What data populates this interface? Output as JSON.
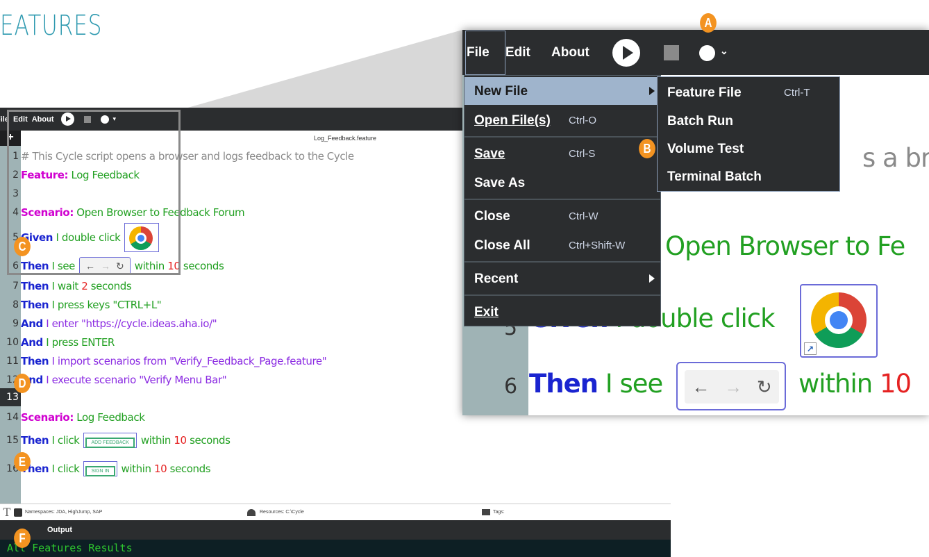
{
  "heading": "EATURES",
  "editor": {
    "menu": {
      "file": "File",
      "edit": "Edit",
      "about": "About"
    },
    "plus": "+",
    "tab_title": "Log_Feedback.feature",
    "lines": [
      {
        "n": "1",
        "comment": "# This Cycle script opens a browser and logs feedback to the Cycle"
      },
      {
        "n": "2",
        "kw": "Feature:",
        "text": " Log Feedback"
      },
      {
        "n": "3"
      },
      {
        "n": "4",
        "kw": "Scenario:",
        "text": " Open Browser to Feedback Forum"
      },
      {
        "n": "5",
        "kw": "Given",
        "text": " I double click"
      },
      {
        "n": "6",
        "kw": "Then",
        "text": " I see",
        "tail": "within",
        "num": "10",
        "tail2": "seconds"
      },
      {
        "n": "7",
        "kw": "Then",
        "text": " I wait",
        "num": "2",
        "tail2": "seconds"
      },
      {
        "n": "8",
        "kw": "Then",
        "text": " I press keys \"CTRL+L\""
      },
      {
        "n": "9",
        "kw": "And",
        "text": " I enter \"https://cycle.ideas.aha.io/\""
      },
      {
        "n": "10",
        "kw": "And",
        "text": " I press ENTER"
      },
      {
        "n": "11",
        "kw": "Then",
        "text": " I import scenarios from \"Verify_Feedback_Page.feature\""
      },
      {
        "n": "12",
        "kw": "And",
        "text": " I execute scenario \"Verify Menu Bar\""
      },
      {
        "n": "13"
      },
      {
        "n": "14",
        "kw": "Scenario:",
        "text": " Log Feedback"
      },
      {
        "n": "15",
        "kw": "Then",
        "text": " I click",
        "btn": "ADD FEEDBACK",
        "tail": "within",
        "num": "10",
        "tail2": "seconds"
      },
      {
        "n": "16",
        "kw": "Then",
        "text": " I click",
        "btn": "SIGN IN",
        "tail": "within",
        "num": "10",
        "tail2": "seconds"
      }
    ],
    "status": {
      "namespaces": "Namespaces: JDA, HighJump, SAP",
      "resources": "Resources: C:\\Cycle",
      "tags": "Tags:"
    },
    "output_label": "Output",
    "output_text": "All Features Results"
  },
  "zoom": {
    "menu": {
      "file": "File",
      "edit": "Edit",
      "about": "About"
    },
    "line_partial": "s a bro",
    "scenario_partial": "Open Browser to Fe",
    "ln5": "5",
    "ln6": "6",
    "given": "Given",
    "given_text": " I double click",
    "then": "Then",
    "then_text": " I see",
    "within": "within",
    "num": "10"
  },
  "file_menu": {
    "items": [
      {
        "label": "New File",
        "shortcut": ""
      },
      {
        "label": "Open File(s)",
        "shortcut": "Ctrl-O"
      },
      {
        "label": "Save",
        "shortcut": "Ctrl-S"
      },
      {
        "label": "Save As",
        "shortcut": ""
      },
      {
        "label": "Close",
        "shortcut": "Ctrl-W"
      },
      {
        "label": "Close All",
        "shortcut": "Ctrl+Shift-W"
      },
      {
        "label": "Recent",
        "shortcut": ""
      },
      {
        "label": "Exit",
        "shortcut": ""
      }
    ]
  },
  "submenu": {
    "items": [
      {
        "label": "Feature File",
        "shortcut": "Ctrl-T"
      },
      {
        "label": "Batch Run",
        "shortcut": ""
      },
      {
        "label": "Volume Test",
        "shortcut": ""
      },
      {
        "label": "Terminal Batch",
        "shortcut": ""
      }
    ]
  },
  "badges": {
    "a": "A",
    "b": "B",
    "c": "C",
    "d": "D",
    "e": "E",
    "f": "F"
  },
  "colors": {
    "keyword": "#1a24d0",
    "feature": "#d000d0",
    "step_text": "#22a022",
    "string": "#8b2be2",
    "number": "#e52222",
    "badge": "#f39321"
  }
}
